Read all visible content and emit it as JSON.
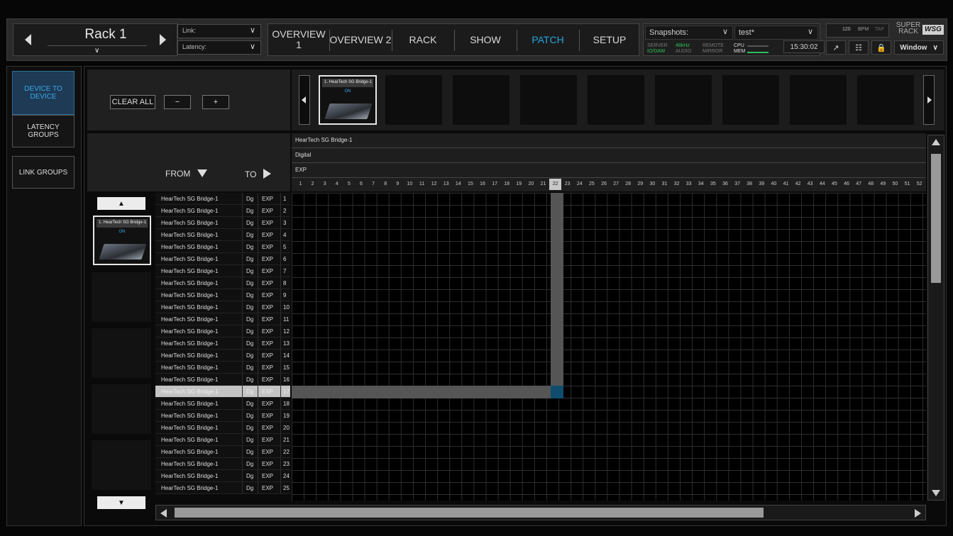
{
  "header": {
    "rack_title": "Rack 1",
    "link_label": "Link:",
    "latency_label": "Latency:",
    "tabs": [
      {
        "label": "OVERVIEW 1"
      },
      {
        "label": "OVERVIEW 2"
      },
      {
        "label": "RACK"
      },
      {
        "label": "SHOW"
      },
      {
        "label": "PATCH",
        "active": true
      },
      {
        "label": "SETUP"
      }
    ],
    "snapshots_label": "Snapshots:",
    "snapshot_value": "test*",
    "status": {
      "server": "SERVER",
      "io_daw": "IO/DAW",
      "sample_rate": "48kHz",
      "audio": "AUDIO",
      "remote": "REMOTE",
      "mirror": "MIRROR",
      "cpu": "CPU",
      "mem": "MEM"
    },
    "clock": "15:30:02",
    "bpm_value": "120",
    "bpm_label": "BPM",
    "tap_label": "TAP",
    "super_rack_line1": "SUPER",
    "super_rack_line2": "RACK",
    "brand": "WSG",
    "window_label": "Window"
  },
  "sidenav": {
    "items": [
      {
        "label": "DEVICE TO DEVICE",
        "active": true
      },
      {
        "label": "LATENCY GROUPS"
      },
      {
        "label": "LINK GROUPS"
      }
    ]
  },
  "patch": {
    "clear_all": "CLEAR ALL",
    "minus": "−",
    "plus": "+",
    "from_label": "FROM",
    "to_label": "TO",
    "device_card_name": "1. HearTech SG Bridge-1",
    "device_card_status": "ON",
    "col_device": "HearTech SG Bridge-1",
    "col_type": "Digital",
    "col_group": "EXP",
    "selected_col": 22,
    "selected_row": 17,
    "row_device": "HearTech SG Bridge-1",
    "row_type": "Dg",
    "row_group": "EXP",
    "row_count": 25,
    "col_count": 52
  },
  "colors": {
    "accent": "#2aa4e0",
    "selected_cell": "#0f4c6e",
    "status_green": "#2fbf5a"
  }
}
